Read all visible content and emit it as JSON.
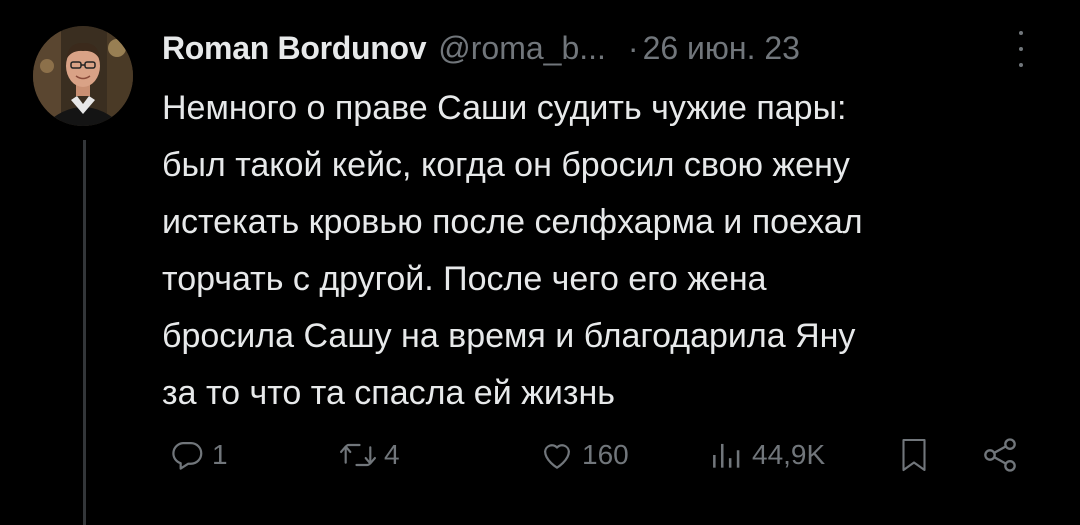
{
  "tweet": {
    "author_name": "Roman Bordunov",
    "handle": "@roma_b...",
    "separator": "·",
    "date": "26 июн. 23",
    "text_lines": [
      "Немного о праве Саши судить чужие пары:",
      "был такой кейс, когда он бросил свою жену",
      "истекать кровью после селфхарма и поехал",
      "торчать с другой. После чего его жена",
      "бросила Сашу на время и благодарила Яну",
      "за то что та спасла ей жизнь"
    ]
  },
  "actions": {
    "replies": "1",
    "retweets": "4",
    "likes": "160",
    "views": "44,9K"
  },
  "icons": {
    "more": "more-vertical-icon",
    "reply": "reply-icon",
    "retweet": "retweet-icon",
    "like": "heart-icon",
    "views": "analytics-icon",
    "bookmark": "bookmark-icon",
    "share": "share-icon"
  },
  "colors": {
    "background": "#000000",
    "text_primary": "#e7e9ea",
    "text_secondary": "#71767b",
    "thread_line": "#333639"
  }
}
